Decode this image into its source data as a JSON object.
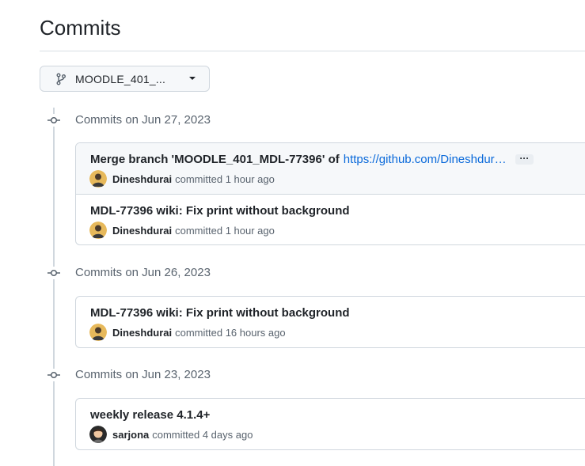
{
  "page": {
    "title": "Commits"
  },
  "branch_selector": {
    "label": "MOODLE_401_..."
  },
  "groups": [
    {
      "label": "Commits on Jun 27, 2023",
      "commits": [
        {
          "title": "Merge branch 'MOODLE_401_MDL-77396' of",
          "link": "https://github.com/Dineshdurai...",
          "has_more": true,
          "more_label": "···",
          "author": "Dineshdurai",
          "time": "committed 1 hour ago"
        },
        {
          "title": "MDL-77396 wiki: Fix print without background",
          "author": "Dineshdurai",
          "time": "committed 1 hour ago"
        }
      ]
    },
    {
      "label": "Commits on Jun 26, 2023",
      "commits": [
        {
          "title": "MDL-77396 wiki: Fix print without background",
          "author": "Dineshdurai",
          "time": "committed 16 hours ago"
        }
      ]
    },
    {
      "label": "Commits on Jun 23, 2023",
      "commits": [
        {
          "title": "weekly release 4.1.4+",
          "author": "sarjona",
          "time": "committed 4 days ago"
        }
      ]
    }
  ],
  "colors": {
    "link": "#0969da",
    "muted_text": "#59636e",
    "border": "#d0d7de",
    "row_highlight": "#f6f8fa"
  }
}
